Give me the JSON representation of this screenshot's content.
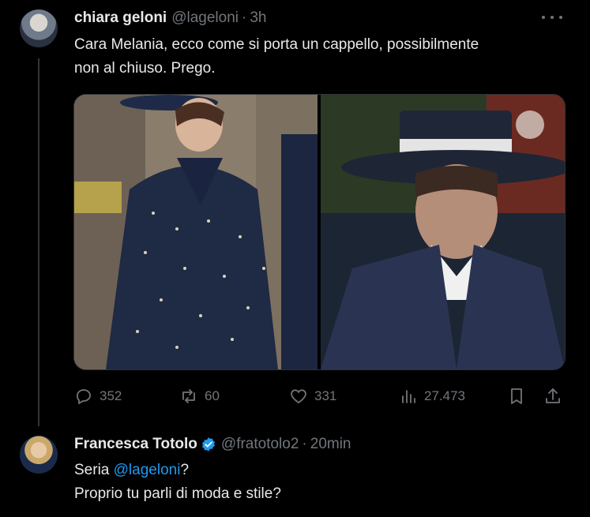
{
  "tweet1": {
    "name": "chiara geloni",
    "handle": "@lageloni",
    "separator": "·",
    "time": "3h",
    "text_line1": "Cara Melania, ecco come si porta un cappello, possibilmente",
    "text_line2": "non al chiuso. Prego.",
    "actions": {
      "replies": "352",
      "reposts": "60",
      "likes": "331",
      "views": "27.473"
    }
  },
  "tweet2": {
    "name": "Francesca Totolo",
    "handle": "@fratotolo2",
    "separator": "·",
    "time": "20min",
    "text_prefix": "Seria ",
    "mention": "@lageloni",
    "text_suffix": "?",
    "text_line2": "Proprio tu parli di moda e stile?"
  },
  "colors": {
    "background": "#000000",
    "text": "#e7e9ea",
    "muted": "#71767b",
    "accent": "#1d9bf0"
  }
}
